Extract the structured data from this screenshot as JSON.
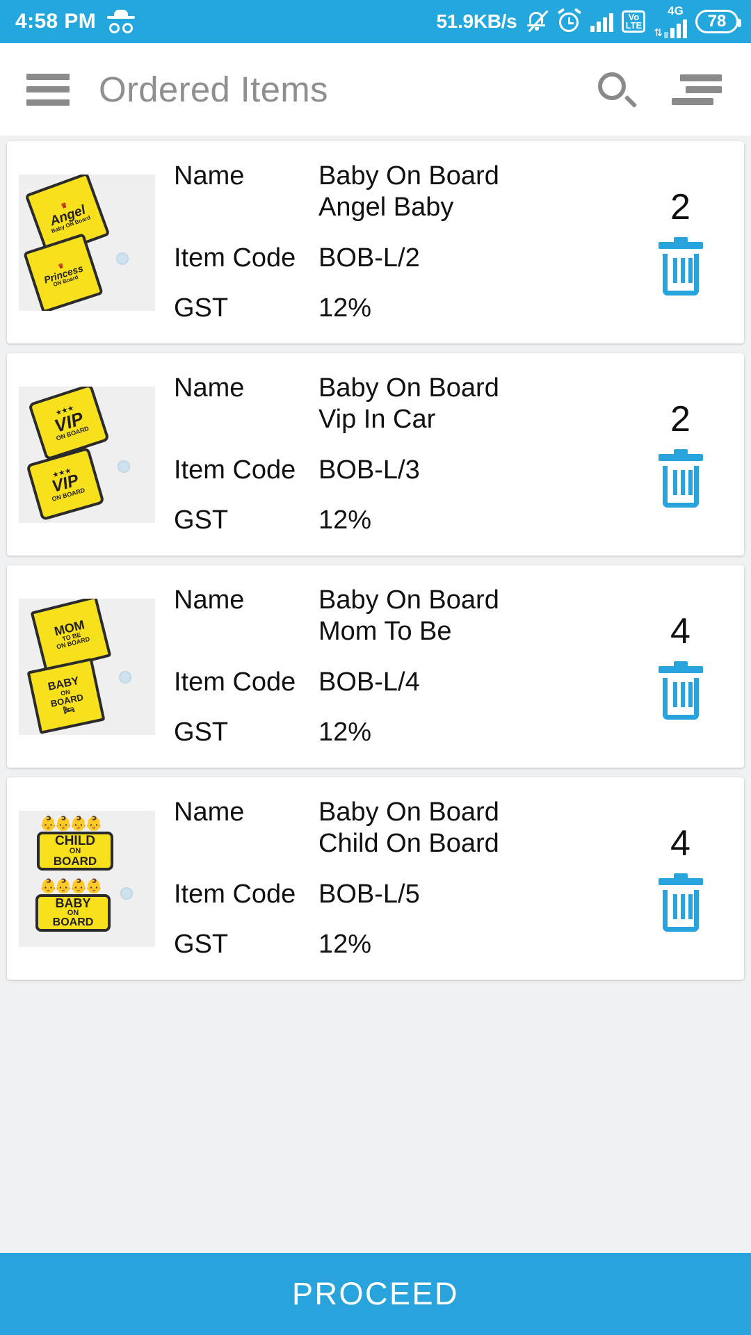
{
  "status_bar": {
    "time": "4:58 PM",
    "incognito_icon": "incognito-icon",
    "network_speed": "51.9KB/s",
    "mute_icon": "bell-mute-icon",
    "alarm_icon": "alarm-clock-icon",
    "signal_icon": "signal-bars-icon",
    "volte_top": "Vo",
    "volte_bottom": "LTE",
    "network_type": "4G",
    "data_arrows": "⇅",
    "battery_level": "78",
    "background_color": "#23a7dd"
  },
  "app_bar": {
    "menu_icon": "hamburger-menu-icon",
    "title": "Ordered Items",
    "search_icon": "search-icon",
    "sort_icon": "sort-icon",
    "background_color": "#ffffff",
    "title_color": "#8f8f8f"
  },
  "labels": {
    "name": "Name",
    "item_code": "Item Code",
    "gst": "GST"
  },
  "items": [
    {
      "name": "Baby On Board Angel Baby",
      "item_code": "BOB-L/2",
      "gst": "12%",
      "quantity": "2",
      "delete_icon": "trash-icon",
      "thumbnail": {
        "alt": "Angel Baby On Board and Princess On Board yellow car signs",
        "sign_top_text": "Angel",
        "sign_top_sub": "Baby ON Board",
        "sign_bottom_text": "Princess",
        "sign_bottom_sub": "ON Board"
      }
    },
    {
      "name": "Baby On Board Vip In Car",
      "item_code": "BOB-L/3",
      "gst": "12%",
      "quantity": "2",
      "delete_icon": "trash-icon",
      "thumbnail": {
        "alt": "VIP On Board yellow car signs with stars",
        "sign_top_text": "VIP",
        "sign_top_sub": "ON BOARD",
        "sign_bottom_text": "VIP",
        "sign_bottom_sub": "ON BOARD"
      }
    },
    {
      "name": "Baby On Board Mom To Be",
      "item_code": "BOB-L/4",
      "gst": "12%",
      "quantity": "4",
      "delete_icon": "trash-icon",
      "thumbnail": {
        "alt": "Mom To Be On Board and Baby On Board yellow car signs",
        "sign_top_text": "MOM",
        "sign_top_sub": "TO BE ON BOARD",
        "sign_bottom_text": "BABY",
        "sign_bottom_sub": "ON BOARD"
      }
    },
    {
      "name": "Baby On Board Child On Board",
      "item_code": "BOB-L/5",
      "gst": "12%",
      "quantity": "4",
      "delete_icon": "trash-icon",
      "thumbnail": {
        "alt": "Child On Board and Baby On Board cartoon character yellow car signs",
        "sign_top_text": "CHILD",
        "sign_top_sub": "ON BOARD",
        "sign_bottom_text": "BABY",
        "sign_bottom_sub": "ON BOARD"
      }
    }
  ],
  "footer": {
    "proceed_label": "PROCEED",
    "background_color": "#29a3dc"
  }
}
